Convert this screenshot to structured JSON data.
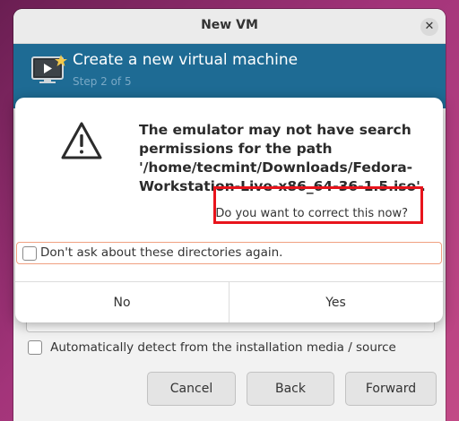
{
  "window": {
    "title": "New VM",
    "close_glyph": "✕"
  },
  "banner": {
    "title": "Create a new virtual machine",
    "step": "Step 2 of 5",
    "icon": "monitor-star-icon"
  },
  "background_form": {
    "auto_detect_label": "Automatically detect from the installation media / source",
    "auto_detect_checked": false,
    "buttons": {
      "cancel": "Cancel",
      "back": "Back",
      "forward": "Forward"
    }
  },
  "dialog": {
    "icon": "warning-icon",
    "message": "The emulator may not have search permissions for the path '/home/tecmint/Downloads/Fedora-Workstation-Live-x86_64-36-1.5.iso'.",
    "question": "Do you want to correct this now?",
    "dont_ask_label": "Don't ask about these directories again.",
    "dont_ask_checked": false,
    "buttons": {
      "no": "No",
      "yes": "Yes"
    }
  },
  "colors": {
    "banner_bg": "#1e6b94",
    "highlight": "#e8141c"
  }
}
